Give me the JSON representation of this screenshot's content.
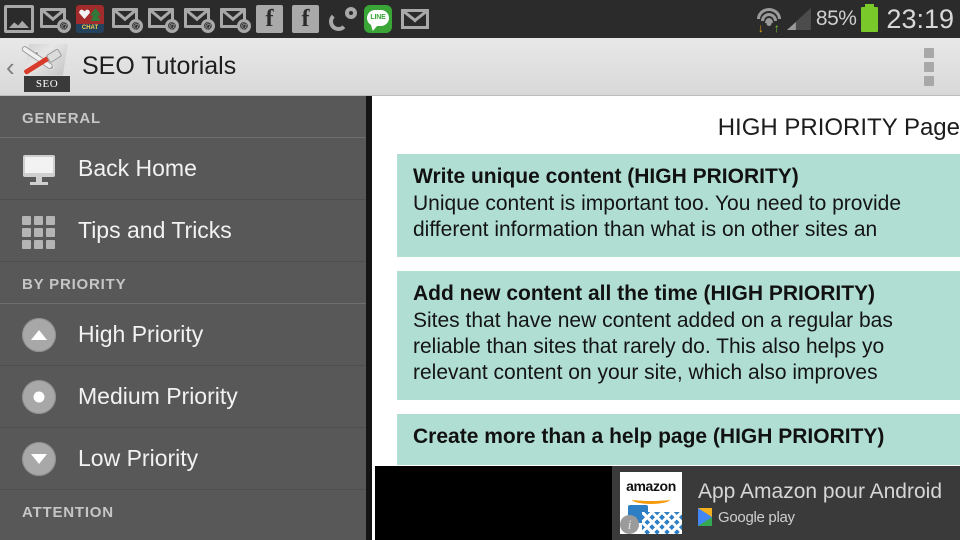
{
  "status_bar": {
    "notification_icons": [
      "photo-icon",
      "mail-at-icon",
      "chat-app-icon",
      "mail-at-icon",
      "mail-at-icon",
      "mail-at-icon",
      "mail-at-icon",
      "facebook-icon",
      "facebook-icon",
      "link-rings-icon",
      "line-app-icon",
      "mail-icon"
    ],
    "chat_app_badge": "CHAT",
    "line_label": "LINE",
    "wifi_icon": "wifi-icon",
    "signal_icon": "signal-icon",
    "battery_percent": "85%",
    "battery_icon": "battery-icon",
    "clock": "23:19",
    "background": "#2b2b2b"
  },
  "action_bar": {
    "up_caret": "‹",
    "app_icon": "seo-tools-icon",
    "app_icon_badge": "SEO",
    "title": "SEO Tutorials",
    "overflow_icon": "overflow-menu-icon"
  },
  "drawer": {
    "background": "#585858",
    "sections": [
      {
        "header": "GENERAL",
        "items": [
          {
            "icon": "monitor-icon",
            "label": "Back Home"
          },
          {
            "icon": "grid-icon",
            "label": "Tips and Tricks"
          }
        ]
      },
      {
        "header": "BY PRIORITY",
        "items": [
          {
            "icon": "arrow-up-circle-icon",
            "label": "High Priority"
          },
          {
            "icon": "dot-circle-icon",
            "label": "Medium Priority"
          },
          {
            "icon": "arrow-down-circle-icon",
            "label": "Low Priority"
          }
        ]
      },
      {
        "header": "ATTENTION",
        "items": []
      }
    ]
  },
  "content": {
    "page_heading": "HIGH PRIORITY Page",
    "card_color": "#b0ded2",
    "cards": [
      {
        "title": "Write unique content (HIGH PRIORITY)",
        "body": "Unique content is important too. You need to provide\ndifferent information than what is on other sites an"
      },
      {
        "title": "Add new content all the time (HIGH PRIORITY)",
        "body": "Sites that have new content added on a regular bas\nreliable than sites that rarely do. This also helps yo\nrelevant content on your site, which also improves"
      },
      {
        "title": "Create more than a help page (HIGH PRIORITY)",
        "body": ""
      }
    ]
  },
  "ad_banner": {
    "background": "#000000",
    "panel_color": "#3a3a3a",
    "icon": "amazon-app-icon",
    "icon_brand": "amazon",
    "info_badge": "i",
    "title": "App Amazon pour Android",
    "store_icon": "google-play-icon",
    "store_label": "Google play"
  }
}
